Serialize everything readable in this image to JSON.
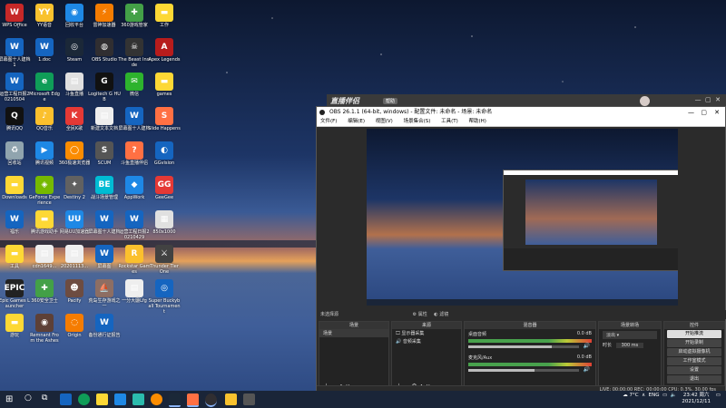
{
  "desktop": {
    "icons": [
      {
        "label": "WPS Office",
        "color": "#c62828",
        "glyph": "W"
      },
      {
        "label": "YY语音",
        "color": "#f9c22e",
        "glyph": "YY"
      },
      {
        "label": "回收平台",
        "color": "#1e88e5",
        "glyph": "◉"
      },
      {
        "label": "雷神加速器",
        "color": "#f57c00",
        "glyph": "⚡"
      },
      {
        "label": "360游戏管家",
        "color": "#43a047",
        "glyph": "✚"
      },
      {
        "label": "工作",
        "color": "#fdd835",
        "glyph": "▬"
      },
      {
        "label": "屏幕图十人建档1",
        "color": "#1565c0",
        "glyph": "W"
      },
      {
        "label": "1.doc",
        "color": "#1565c0",
        "glyph": "W"
      },
      {
        "label": "Steam",
        "color": "#1b2838",
        "glyph": "◎"
      },
      {
        "label": "OBS Studio",
        "color": "#302e31",
        "glyph": "◍"
      },
      {
        "label": "The Beast Inside",
        "color": "#333",
        "glyph": "☠"
      },
      {
        "label": "Apex Legends",
        "color": "#b71c1c",
        "glyph": "A"
      },
      {
        "label": "运营工程日报20210504",
        "color": "#1565c0",
        "glyph": "W"
      },
      {
        "label": "Microsoft Edge",
        "color": "#0f9d58",
        "glyph": "e"
      },
      {
        "label": "斗鱼直播",
        "color": "#e0e0e0",
        "glyph": "▤"
      },
      {
        "label": "Logitech G HUB",
        "color": "#111",
        "glyph": "G"
      },
      {
        "label": "微信",
        "color": "#2db32d",
        "glyph": "✉"
      },
      {
        "label": "games",
        "color": "#fdd835",
        "glyph": "▬"
      },
      {
        "label": "腾讯QQ",
        "color": "#111",
        "glyph": "Q"
      },
      {
        "label": "QQ音乐",
        "color": "#fbc02d",
        "glyph": "♪"
      },
      {
        "label": "全民K歌",
        "color": "#e53935",
        "glyph": "K"
      },
      {
        "label": "新建文本文档",
        "color": "#eeeeee",
        "glyph": "▤"
      },
      {
        "label": "屏幕图十人建档",
        "color": "#1565c0",
        "glyph": "W"
      },
      {
        "label": "Slide Happens",
        "color": "#ff7043",
        "glyph": "S"
      },
      {
        "label": "回收站",
        "color": "#90a4ae",
        "glyph": "♻"
      },
      {
        "label": "腾讯视频",
        "color": "#1e88e5",
        "glyph": "▶"
      },
      {
        "label": "360极速浏览器",
        "color": "#fb8c00",
        "glyph": "◯"
      },
      {
        "label": "SCUM",
        "color": "#555",
        "glyph": "S"
      },
      {
        "label": "斗鱼直播伴侣",
        "color": "#ff7043",
        "glyph": "?"
      },
      {
        "label": "GGvision",
        "color": "#1565c0",
        "glyph": "◐"
      },
      {
        "label": "Downloads",
        "color": "#fdd835",
        "glyph": "▬"
      },
      {
        "label": "GeForce Experience",
        "color": "#76b900",
        "glyph": "◈"
      },
      {
        "label": "Destiny 2",
        "color": "#616161",
        "glyph": "✦"
      },
      {
        "label": "战斗场景管理",
        "color": "#00bcd4",
        "glyph": "BE"
      },
      {
        "label": "AppWork",
        "color": "#1e88e5",
        "glyph": "◆"
      },
      {
        "label": "GeeGee",
        "color": "#e53935",
        "glyph": "GG"
      },
      {
        "label": "福乐",
        "color": "#1565c0",
        "glyph": "W"
      },
      {
        "label": "腾讯游戏助手",
        "color": "#fdd835",
        "glyph": "▬"
      },
      {
        "label": "网易UU加速器",
        "color": "#1e88e5",
        "glyph": "UU"
      },
      {
        "label": "屏幕图十人建档",
        "color": "#1565c0",
        "glyph": "W"
      },
      {
        "label": "运营工程日报20210429",
        "color": "#1565c0",
        "glyph": "W"
      },
      {
        "label": "850x1000",
        "color": "#e0e0e0",
        "glyph": "▦"
      },
      {
        "label": "工具",
        "color": "#fdd835",
        "glyph": "▬"
      },
      {
        "label": "cdn1649...",
        "color": "#eeeeee",
        "glyph": "▤"
      },
      {
        "label": "20201113...",
        "color": "#eeeeee",
        "glyph": "▤"
      },
      {
        "label": "屏幕图",
        "color": "#1565c0",
        "glyph": "W"
      },
      {
        "label": "Rockstar Games",
        "color": "#fbc02d",
        "glyph": "R"
      },
      {
        "label": "Thunder Tier One",
        "color": "#424242",
        "glyph": "⚔"
      },
      {
        "label": "Epic Games Launcher",
        "color": "#222",
        "glyph": "EPIC"
      },
      {
        "label": "360安全卫士",
        "color": "#43a047",
        "glyph": "✚"
      },
      {
        "label": "Pacify",
        "color": "#6d4c41",
        "glyph": "☻"
      },
      {
        "label": "荒岛生存游戏之一",
        "color": "#8d6e63",
        "glyph": "⛵"
      },
      {
        "label": "一分大廳Lfg",
        "color": "#eeeeee",
        "glyph": "▤"
      },
      {
        "label": "Super Buckyball Tournament",
        "color": "#1565c0",
        "glyph": "◎"
      },
      {
        "label": "游玩",
        "color": "#fdd835",
        "glyph": "▬"
      },
      {
        "label": "Remnant From the Ashes",
        "color": "#5d4037",
        "glyph": "◉"
      },
      {
        "label": "Origin",
        "color": "#f57c00",
        "glyph": "◌"
      },
      {
        "label": "备份通行证报告",
        "color": "#1565c0",
        "glyph": "W"
      }
    ]
  },
  "obs": {
    "banner_text": "直播伴侣",
    "banner_badge": "帮助",
    "title": "OBS 26.1.1 (64-bit, windows) - 配置文件: 未命名 - 场景: 未命名",
    "menu": [
      "文件(F)",
      "编辑(E)",
      "视图(V)",
      "场景集合(S)",
      "工具(T)",
      "帮助(H)"
    ],
    "left_tabs": [
      "未选择源",
      "属性",
      "滤镜"
    ],
    "panels": {
      "scenes": {
        "title": "场景",
        "items": [
          "场景"
        ]
      },
      "sources": {
        "title": "来源",
        "items": [
          "显示器采集",
          "音频采集"
        ]
      },
      "mixer": {
        "title": "混音器",
        "tracks": [
          {
            "name": "桌面音频",
            "db": "0.0 dB",
            "level": 0.75
          },
          {
            "name": "麦克风/Aux",
            "db": "0.0 dB",
            "level": 0.6
          }
        ]
      },
      "transitions": {
        "title": "场景转场",
        "mode": "淡出",
        "duration_label": "时长",
        "duration": "300 ms"
      },
      "controls": {
        "title": "控件",
        "buttons": [
          "开始推流",
          "开始录制",
          "启动虚拟摄像机",
          "工作室模式",
          "设置",
          "退出"
        ]
      }
    },
    "status": "LIVE: 00:00:00   REC: 00:00:00   CPU: 0.3%, 30.00 fps"
  },
  "taskbar": {
    "weather": "7°C",
    "lang": "ENG",
    "time": "23:42 周六",
    "date": "2021/12/11"
  }
}
